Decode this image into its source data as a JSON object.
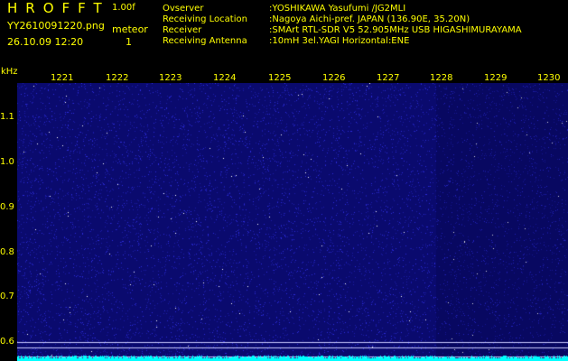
{
  "header": {
    "app_name": "HROFFT",
    "version": "1.00f",
    "filename": "YY2610091220.png",
    "timestamp": "26.10.09 12:20",
    "meteor_label": "meteor",
    "meteor_count": "1"
  },
  "info": [
    {
      "label": "Ovserver",
      "value": ":YOSHIKAWA Yasufumi /JG2MLI"
    },
    {
      "label": "Receiving Location",
      "value": ":Nagoya Aichi-pref. JAPAN (136.90E, 35.20N)"
    },
    {
      "label": "Receiver",
      "value": ":SMArt RTL-SDR V5 52.905MHz USB HIGASHIMURAYAMA"
    },
    {
      "label": "Receiving Antenna",
      "value": ":10mH 3el.YAGI Horizontal:ENE"
    }
  ],
  "spectrogram": {
    "unit_label": "kHz",
    "time_ticks": [
      "1221",
      "1222",
      "1223",
      "1224",
      "1225",
      "1226",
      "1227",
      "1228",
      "1229",
      "1230"
    ],
    "freq_ticks": [
      "1.1",
      "1.0",
      "0.9",
      "0.8",
      "0.7",
      "0.6"
    ],
    "freq_range_khz": [
      0.58,
      1.18
    ],
    "background_color": "#0a0a6e",
    "noise_color": "#2a2ad8",
    "signal_color": "#ffffff",
    "baseline_color": "#00ffff",
    "reference_lines_khz": [
      0.61,
      0.62,
      0.59
    ]
  },
  "colors": {
    "text": "#ffff00",
    "header_bg": "#000000"
  }
}
